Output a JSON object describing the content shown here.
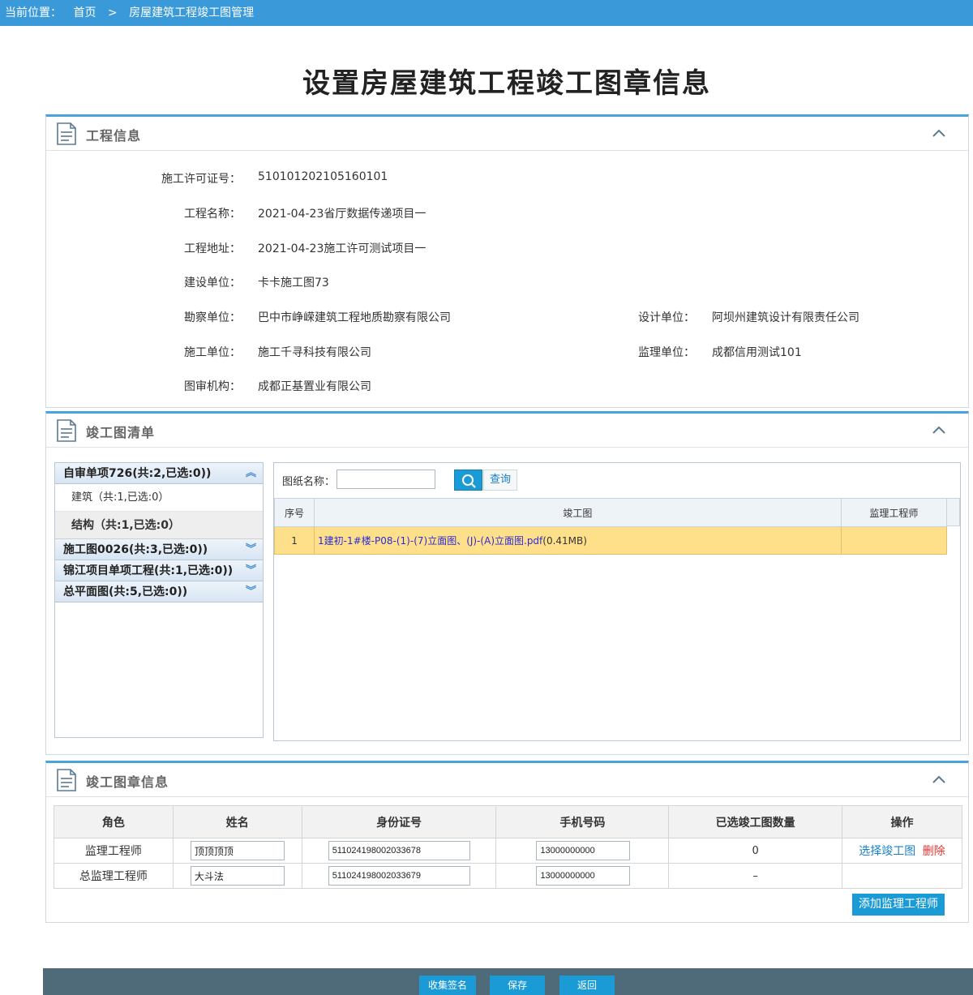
{
  "breadcrumb": {
    "label": "当前位置：",
    "home": "首页",
    "sep": ">",
    "current": "房屋建筑工程竣工图管理"
  },
  "title": "设置房屋建筑工程竣工图章信息",
  "project": {
    "header": "工程信息",
    "permit_label": "施工许可证号：",
    "permit": "510101202105160101",
    "name_label": "工程名称：",
    "name": "2021-04-23省厅数据传递项目一",
    "address_label": "工程地址：",
    "address": "2021-04-23施工许可测试项目一",
    "builder_label": "建设单位：",
    "builder": "卡卡施工图73",
    "survey_label": "勘察单位：",
    "survey": "巴中市峥嵘建筑工程地质勘察有限公司",
    "design_label": "设计单位：",
    "design": "阿坝州建筑设计有限责任公司",
    "construct_label": "施工单位：",
    "construct": "施工千寻科技有限公司",
    "supervise_label": "监理单位：",
    "supervise": "成都信用测试101",
    "review_label": "图审机构：",
    "review": "成都正基置业有限公司"
  },
  "list": {
    "header": "竣工图清单",
    "groups": [
      {
        "label": "自审单项726(共:2,已选:0))",
        "arrow": "︽"
      },
      {
        "label": "施工图0026(共:3,已选:0))",
        "arrow": "︾"
      },
      {
        "label": "锦江项目单项工程(共:1,已选:0))",
        "arrow": "︾"
      },
      {
        "label": "总平面图(共:5,已选:0))",
        "arrow": "︾"
      }
    ],
    "group0_items": {
      "a": "建筑（共:1,已选:0）",
      "b": "结构（共:1,已选:0）"
    },
    "search_label": "图纸名称：",
    "search_value": "",
    "query_label": "查询",
    "cols": {
      "seq": "序号",
      "drawing": "竣工图",
      "engineer": "监理工程师"
    },
    "row": {
      "seq": "1",
      "file": "1建初-1#楼-P08-(1)-(7)立面图、(J)-(A)立面图.pdf",
      "size": "(0.41MB)",
      "engineer": ""
    }
  },
  "seal": {
    "header": "竣工图章信息",
    "cols": {
      "role": "角色",
      "name": "姓名",
      "id": "身份证号",
      "phone": "手机号码",
      "count": "已选竣工图数量",
      "op": "操作"
    },
    "rows": [
      {
        "role": "监理工程师",
        "name": "顶顶顶顶",
        "id": "511024198002033678",
        "phone": "13000000000",
        "count": "0",
        "op_select": "选择竣工图",
        "op_delete": "删除"
      },
      {
        "role": "总监理工程师",
        "name": "大斗法",
        "id": "511024198002033679",
        "phone": "13000000000",
        "count": "–"
      }
    ],
    "add_button": "添加监理工程师"
  },
  "footer": {
    "collect": "收集签名",
    "save": "保存",
    "back": "返回"
  },
  "colors": {
    "topbar": "#3a9ad9",
    "accent": "#1b9bd6",
    "highlight_row": "#ffe08a",
    "link": "#2b2bd6",
    "delete": "#e53030",
    "footer": "#4f6b7a"
  }
}
